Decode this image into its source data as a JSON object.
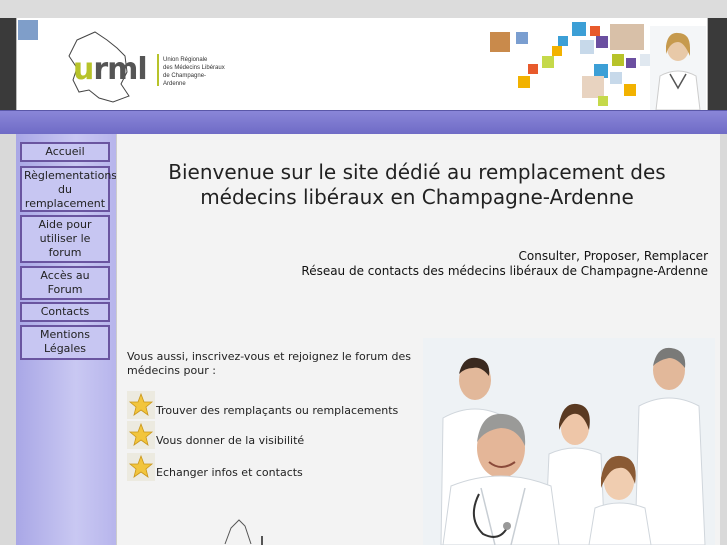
{
  "header": {
    "logo_word": "urml",
    "logo_lines": [
      "Union Régionale",
      "des Médecins Libéraux",
      "de Champagne-Ardenne"
    ]
  },
  "sidebar": {
    "items": [
      {
        "label": "Accueil"
      },
      {
        "label": "Règlementations du remplacement"
      },
      {
        "label": "Aide pour utiliser le forum"
      },
      {
        "label": "Accès au Forum"
      },
      {
        "label": "Contacts"
      },
      {
        "label": "Mentions Légales"
      }
    ]
  },
  "main": {
    "welcome_line1": "Bienvenue sur le site dédié au remplacement des",
    "welcome_line2": "médecins libéraux en Champagne-Ardenne",
    "tagline1": "Consulter, Proposer, Remplacer",
    "tagline2": "Réseau de contacts des médecins libéraux de Champagne-Ardenne",
    "invite": "Vous aussi, inscrivez-vous et rejoignez le forum des médecins pour :",
    "benefits": [
      {
        "label": "Trouver des remplaçants ou remplacements"
      },
      {
        "label": "Vous donner de la visibilité"
      },
      {
        "label": "Echanger infos et contacts"
      }
    ]
  },
  "colors": {
    "accent_purple": "#6f6bc6",
    "nav_border": "#6a55a0",
    "logo_green": "#b7c32a"
  },
  "icons": {
    "benefit_bullet": "star-icon"
  }
}
